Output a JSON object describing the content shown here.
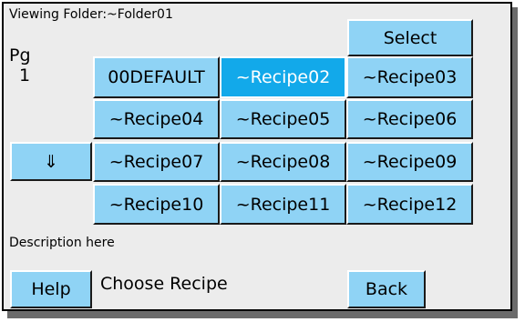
{
  "header": {
    "viewing_folder": "Viewing Folder:~Folder01"
  },
  "page_indicator": {
    "label": "Pg",
    "number": "1"
  },
  "buttons": {
    "select": "Select",
    "down_icon": "down-arrow-icon",
    "down_glyph": "⇓",
    "help": "Help",
    "back": "Back"
  },
  "recipes": [
    "00DEFAULT",
    "~Recipe02",
    "~Recipe03",
    "~Recipe04",
    "~Recipe05",
    "~Recipe06",
    "~Recipe07",
    "~Recipe08",
    "~Recipe09",
    "~Recipe10",
    "~Recipe11",
    "~Recipe12"
  ],
  "selected_recipe": "~Recipe02",
  "description": "Description here",
  "prompt": "Choose Recipe",
  "colors": {
    "button": "#8fd3f5",
    "selected": "#12a9ea",
    "background": "#ececec"
  }
}
